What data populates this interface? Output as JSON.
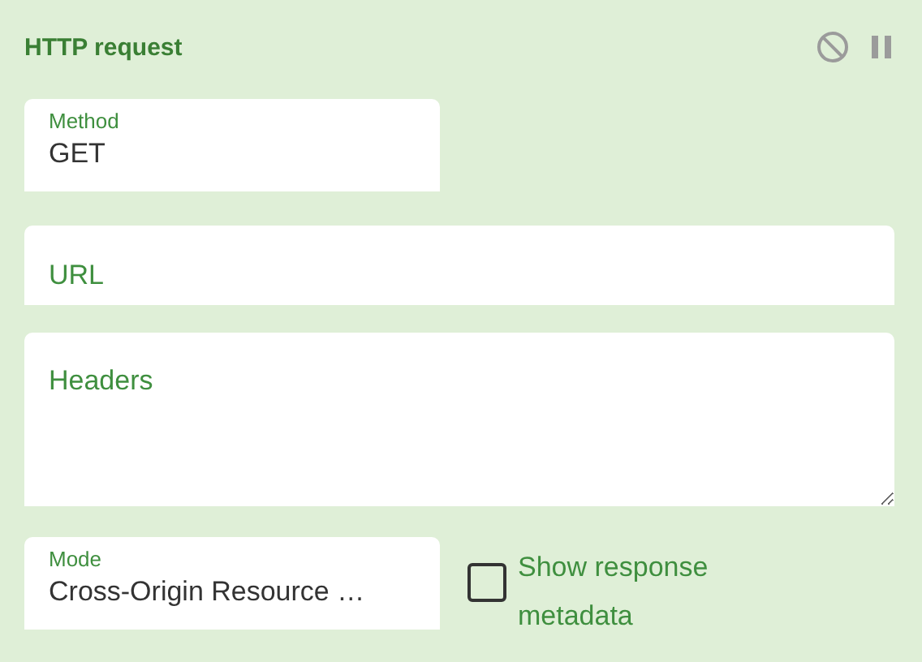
{
  "node": {
    "title": "HTTP request"
  },
  "method": {
    "label": "Method",
    "value": "GET"
  },
  "url": {
    "placeholder": "URL"
  },
  "headers": {
    "placeholder": "Headers"
  },
  "mode": {
    "label": "Mode",
    "value": "Cross-Origin Resource …"
  },
  "show_metadata": {
    "label": "Show response metadata",
    "checked": false
  }
}
